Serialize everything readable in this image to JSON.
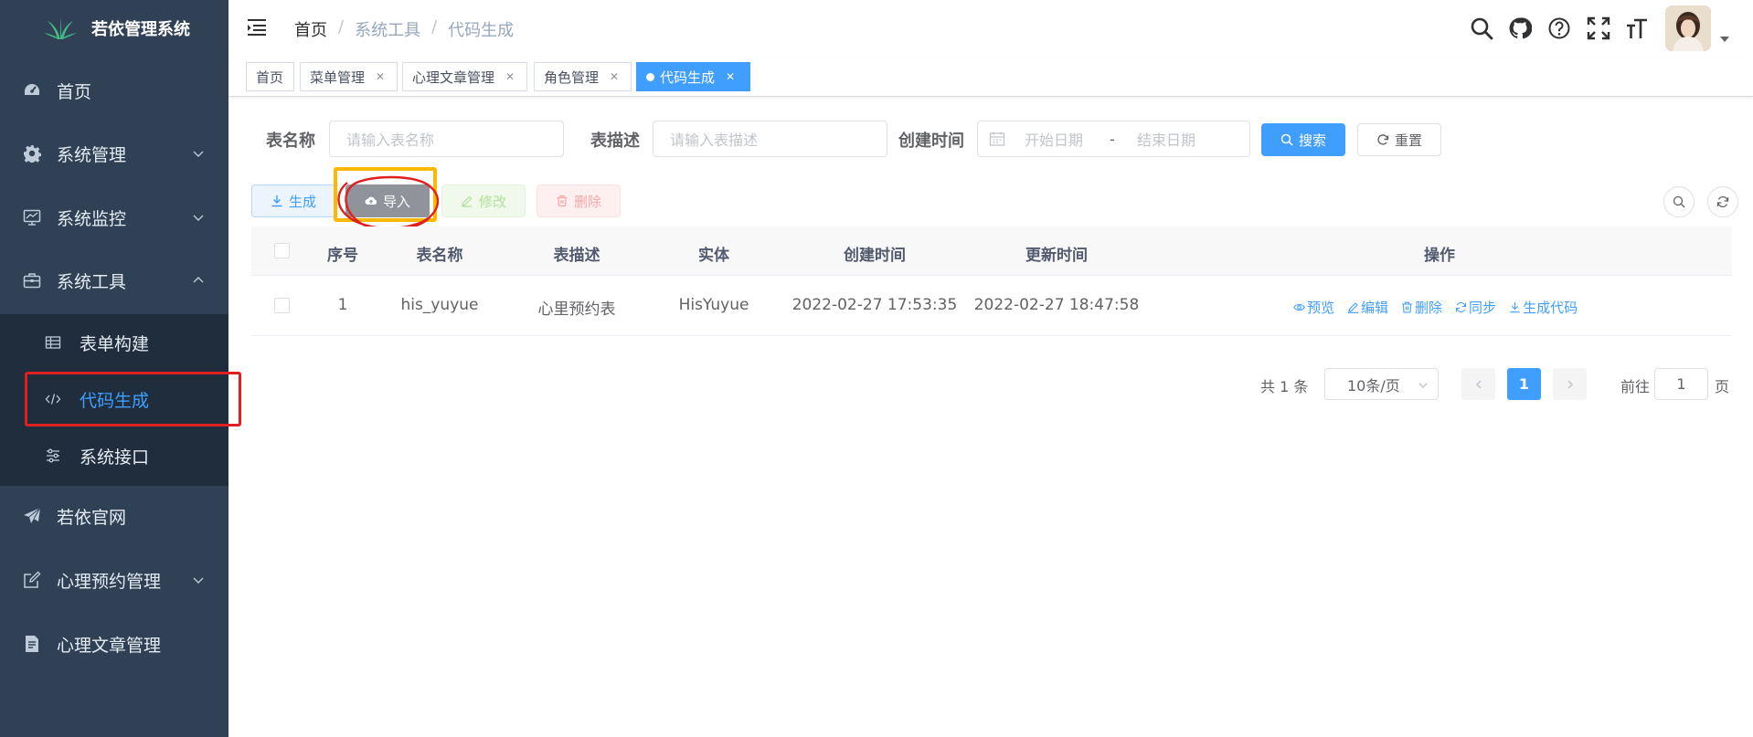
{
  "app": {
    "title": "若依管理系统"
  },
  "sidebar": {
    "items": [
      {
        "label": "首页",
        "icon": "dashboard-icon"
      },
      {
        "label": "系统管理",
        "icon": "gear-icon"
      },
      {
        "label": "系统监控",
        "icon": "monitor-icon"
      },
      {
        "label": "系统工具",
        "icon": "toolbox-icon",
        "expanded": true
      },
      {
        "label": "若依官网",
        "icon": "paper-plane-icon"
      },
      {
        "label": "心理预约管理",
        "icon": "edit-icon"
      },
      {
        "label": "心理文章管理",
        "icon": "document-icon"
      }
    ],
    "sub_items": [
      {
        "label": "表单构建",
        "icon": "table-icon"
      },
      {
        "label": "代码生成",
        "icon": "code-icon",
        "active": true
      },
      {
        "label": "系统接口",
        "icon": "sliders-icon"
      }
    ]
  },
  "navbar": {
    "breadcrumb": [
      "首页",
      "系统工具",
      "代码生成"
    ],
    "separator": "/"
  },
  "tags": [
    {
      "label": "首页",
      "closable": false
    },
    {
      "label": "菜单管理",
      "closable": true
    },
    {
      "label": "心理文章管理",
      "closable": true
    },
    {
      "label": "角色管理",
      "closable": true
    },
    {
      "label": "代码生成",
      "closable": true,
      "active": true
    }
  ],
  "search": {
    "table_name_label": "表名称",
    "table_name_placeholder": "请输入表名称",
    "table_desc_label": "表描述",
    "table_desc_placeholder": "请输入表描述",
    "create_time_label": "创建时间",
    "start_date_placeholder": "开始日期",
    "date_separator": "-",
    "end_date_placeholder": "结束日期",
    "search_button": "搜索",
    "reset_button": "重置"
  },
  "toolbar": {
    "generate": "生成",
    "import": "导入",
    "edit": "修改",
    "delete": "删除"
  },
  "table": {
    "columns": [
      "序号",
      "表名称",
      "表描述",
      "实体",
      "创建时间",
      "更新时间",
      "操作"
    ],
    "rows": [
      {
        "index": "1",
        "table_name": "his_yuyue",
        "table_desc": "心里预约表",
        "entity": "HisYuyue",
        "create_time": "2022-02-27 17:53:35",
        "update_time": "2022-02-27 18:47:58",
        "actions": [
          "预览",
          "编辑",
          "删除",
          "同步",
          "生成代码"
        ]
      }
    ]
  },
  "pagination": {
    "total_text": "共 1 条",
    "page_size": "10条/页",
    "current_page": "1",
    "goto_label": "前往",
    "goto_value": "1",
    "page_suffix": "页"
  },
  "colors": {
    "sidebar_bg": "#304156",
    "submenu_bg": "#1f2d3d",
    "primary": "#409eff",
    "annotation_red": "#e02020",
    "annotation_yellow": "#ffb800"
  }
}
